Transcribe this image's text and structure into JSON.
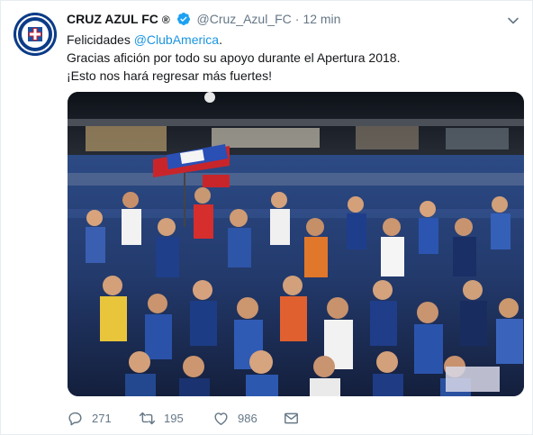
{
  "tweet": {
    "display_name": "CRUZ AZUL FC",
    "registered_mark": "®",
    "handle": "@Cruz_Azul_FC",
    "separator": "·",
    "time": "12 min",
    "text": {
      "line1_prefix": "Felicidades ",
      "line1_mention": "@ClubAmerica",
      "line1_suffix": ".",
      "line2": "Gracias afición por todo su apoyo durante el Apertura 2018.",
      "line3": "¡Esto nos hará regresar más fuertes!"
    },
    "actions": {
      "replies": "271",
      "retweets": "195",
      "likes": "986"
    }
  },
  "icons": {
    "avatar": "cruz-azul-crest",
    "verified": "verified-badge-icon",
    "menu": "chevron-down-icon",
    "reply": "reply-icon",
    "retweet": "retweet-icon",
    "like": "heart-icon",
    "dm": "envelope-icon"
  },
  "colors": {
    "accent": "#1b95e0",
    "text": "#14171a",
    "muted": "#657786",
    "border": "#e6ecf0"
  }
}
